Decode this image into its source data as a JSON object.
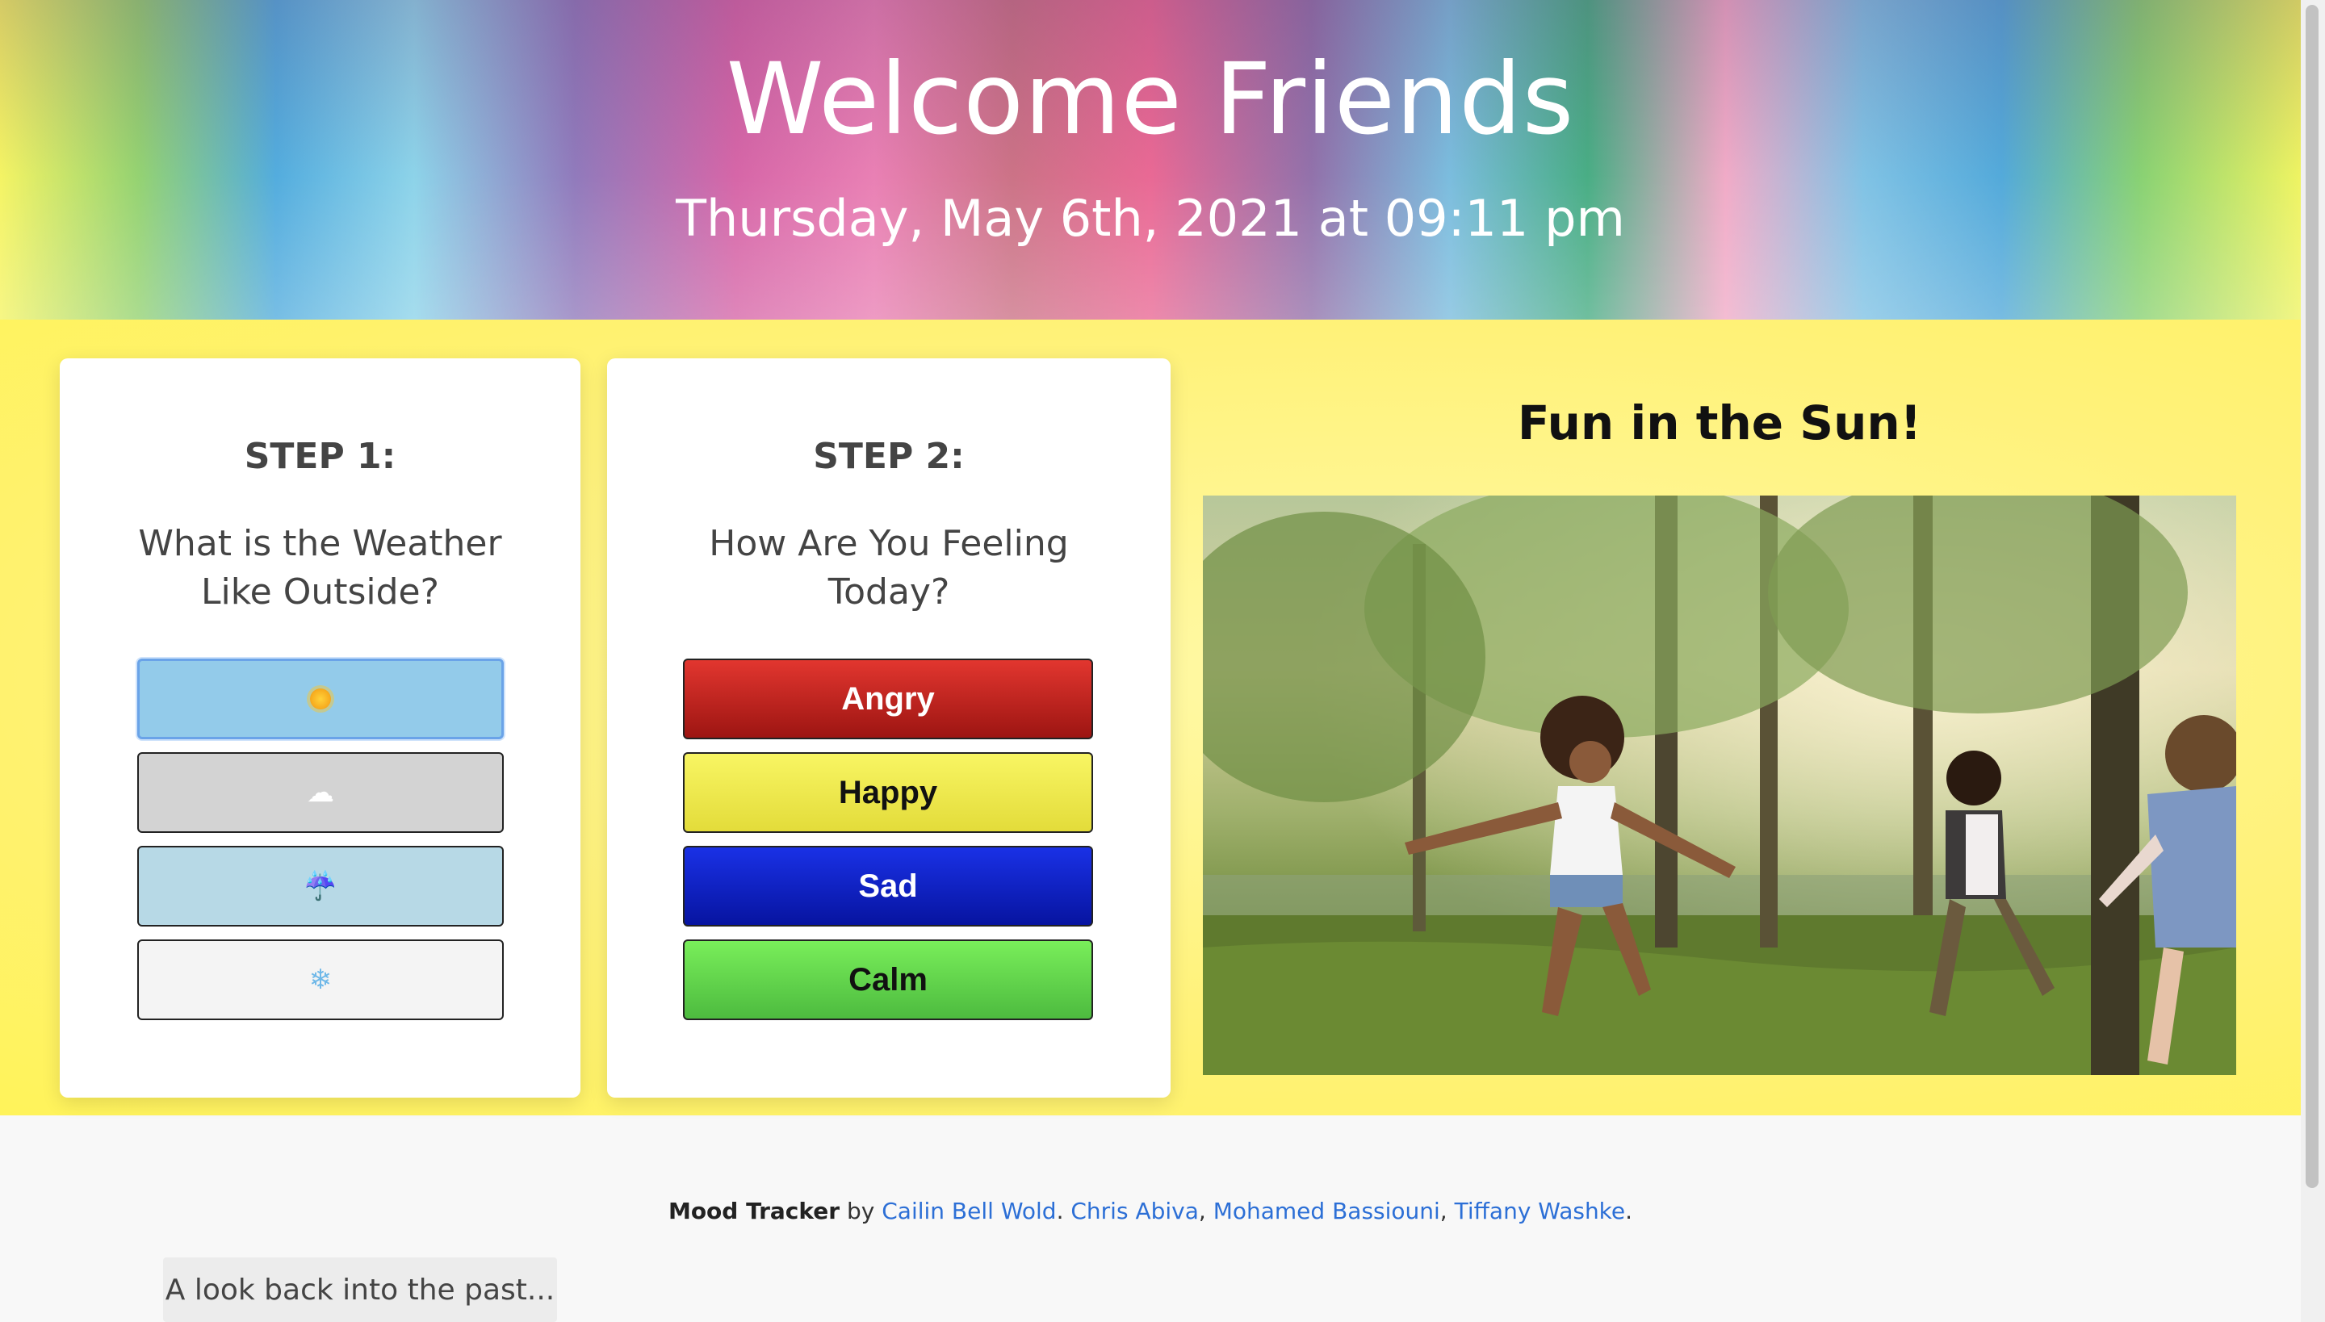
{
  "header": {
    "title": "Welcome Friends",
    "datetime": "Thursday, May 6th, 2021 at 09:11 pm"
  },
  "step1": {
    "heading": "STEP 1:",
    "question": "What is the Weather Like Outside?",
    "options": [
      {
        "icon": "sun-icon",
        "glyph": "☀"
      },
      {
        "icon": "cloud-icon",
        "glyph": "☁"
      },
      {
        "icon": "umbrella-rain-icon",
        "glyph": "☔"
      },
      {
        "icon": "snowflake-icon",
        "glyph": "❄"
      }
    ]
  },
  "step2": {
    "heading": "STEP 2:",
    "question": "How Are You Feeling Today?",
    "options": [
      "Angry",
      "Happy",
      "Sad",
      "Calm"
    ]
  },
  "feature": {
    "title": "Fun in the Sun!"
  },
  "footer": {
    "app_name": "Mood Tracker",
    "by": "by",
    "authors": [
      "Cailin Bell Wold",
      "Chris Abiva",
      "Mohamed Bassiouni",
      "Tiffany Washke"
    ],
    "sep1": ".",
    "sep2": ",",
    "sep3": ",",
    "end": ".",
    "past_button": "A look back into the past..."
  },
  "colors": {
    "band": "#fff27a",
    "link": "#2c6fd6",
    "angry": "#c9241f",
    "happy": "#f1ec4d",
    "sad": "#0d22c8",
    "calm": "#63d64c"
  }
}
